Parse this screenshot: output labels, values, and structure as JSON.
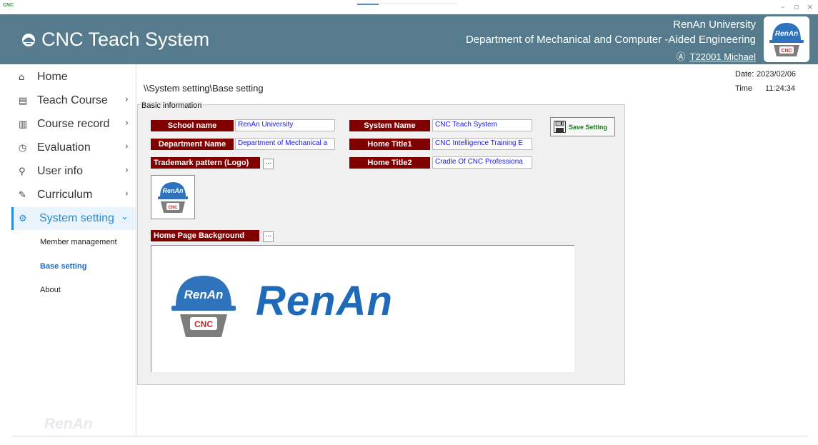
{
  "window": {
    "icon_text": "CNC",
    "controls": {
      "minimize": "–",
      "restore": "▫",
      "close": "×"
    }
  },
  "header": {
    "app_title": "CNC Teach System",
    "university": "RenAn University",
    "department": "Department of Mechanical and Computer -Aided  Engineering",
    "user_icon": "Ⓐ",
    "user": "T22001 Michael",
    "badge_top": "RenAn",
    "badge_bottom": "CNC"
  },
  "sidebar": {
    "items": [
      {
        "label": "Home",
        "icon": "⌂",
        "chevron": ""
      },
      {
        "label": "Teach Course",
        "icon": "▤",
        "chevron": "›"
      },
      {
        "label": "Course record",
        "icon": "▥",
        "chevron": "›"
      },
      {
        "label": "Evaluation",
        "icon": "◷",
        "chevron": "›"
      },
      {
        "label": "User info",
        "icon": "⚲",
        "chevron": "›"
      },
      {
        "label": "Curriculum",
        "icon": "✎",
        "chevron": "›"
      },
      {
        "label": "System setting",
        "icon": "⚙",
        "chevron": "⌄"
      }
    ],
    "subitems": [
      {
        "label": "Member management"
      },
      {
        "label": "Base setting"
      },
      {
        "label": "About"
      }
    ],
    "watermark": "RenAn"
  },
  "main": {
    "breadcrumb": "\\\\System setting\\Base setting",
    "date_label": "Date:",
    "date_value": "2023/02/06",
    "time_label": "Time",
    "time_value": "11:24:34",
    "group_title": "Basic information",
    "fields": {
      "school_name_label": "School name",
      "school_name_value": "RenAn University",
      "department_name_label": "Department Name",
      "department_name_value": "Department of Mechanical a",
      "trademark_label": "Trademark pattern (Logo)",
      "system_name_label": "System Name",
      "system_name_value": "CNC Teach System",
      "home_title1_label": "Home Title1",
      "home_title1_value": "CNC Intelligence Training E",
      "home_title2_label": "Home Title2",
      "home_title2_value": "Cradle Of CNC Professiona",
      "home_bg_label": "Home Page Background"
    },
    "browse_label": "...",
    "save_button": "Save Setting",
    "logo_top": "RenAn",
    "logo_bottom": "CNC",
    "bg_logo_top": "RenAn",
    "bg_logo_bottom": "CNC",
    "bg_wordmark": "RenAn"
  },
  "colors": {
    "header_bg": "#557b8c",
    "label_bg": "#800000",
    "active_nav": "#2a8ad4",
    "field_text": "#1a1adc",
    "brand_blue": "#1e69b8",
    "save_text": "#1e7a1e"
  },
  "icons": {
    "app": "helmet-icon",
    "user": "user-circle-icon",
    "save": "floppy-disk-icon"
  }
}
